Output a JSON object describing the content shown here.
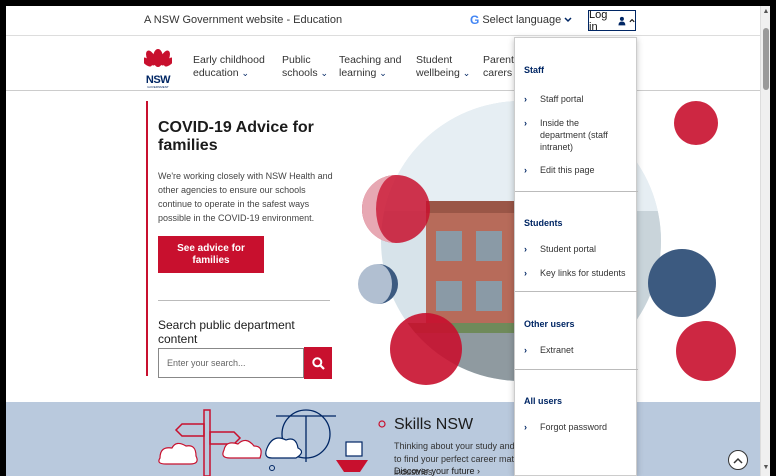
{
  "utility": {
    "gov_text": "A NSW Government website - Education",
    "language_label": "Select language",
    "google_glyph": "G",
    "login_label": "Log in"
  },
  "logo": {
    "text": "NSW",
    "subtext": "GOVERNMENT"
  },
  "nav": {
    "items": [
      {
        "line1": "Early childhood",
        "line2": "education"
      },
      {
        "line1": "Public",
        "line2": "schools"
      },
      {
        "line1": "Teaching and",
        "line2": "learning"
      },
      {
        "line1": "Student",
        "line2": "wellbeing"
      },
      {
        "line1": "Parents",
        "line2": "carers"
      }
    ]
  },
  "hero": {
    "title": "COVID-19 Advice for families",
    "text": "We're working closely with NSW Health and other agencies to ensure our schools continue to operate in the safest ways possible in the COVID-19 environment.",
    "button_label": "See advice for families",
    "search_title": "Search public department content",
    "search_placeholder": "Enter your search..."
  },
  "skills": {
    "title": "Skills NSW",
    "text": "Thinking about your study and career options? Take a quiz to find your perfect career match or explore courses and industries.",
    "link": "Discover your future"
  },
  "dropdown": {
    "staff": {
      "heading": "Staff",
      "items": [
        "Staff portal",
        "Inside the department (staff intranet)",
        "Edit this page"
      ]
    },
    "students": {
      "heading": "Students",
      "items": [
        "Student portal",
        "Key links for students"
      ]
    },
    "other": {
      "heading": "Other users",
      "items": [
        "Extranet"
      ]
    },
    "all": {
      "heading": "All users",
      "items": [
        "Forgot password"
      ]
    }
  },
  "colors": {
    "brand_red": "#c8102e",
    "brand_navy": "#002664",
    "band_blue": "#b9c9dd"
  },
  "icons": [
    "chevron-down-icon",
    "user-icon",
    "search-icon",
    "chevron-right-icon",
    "arrow-up-icon",
    "waratah-logo"
  ]
}
